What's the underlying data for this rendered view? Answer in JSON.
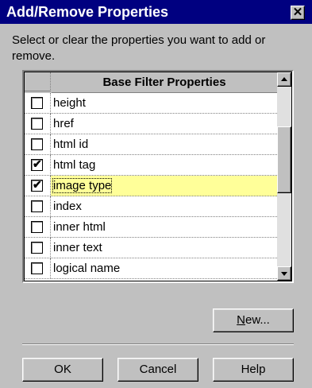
{
  "window": {
    "title": "Add/Remove Properties",
    "close_symbol": "✕"
  },
  "instructions": "Select or clear the properties you want to add or remove.",
  "table": {
    "header": "Base Filter Properties",
    "rows": [
      {
        "label": "height",
        "checked": false,
        "selected": false
      },
      {
        "label": "href",
        "checked": false,
        "selected": false
      },
      {
        "label": "html id",
        "checked": false,
        "selected": false
      },
      {
        "label": "html tag",
        "checked": true,
        "selected": false
      },
      {
        "label": "image type",
        "checked": true,
        "selected": true
      },
      {
        "label": "index",
        "checked": false,
        "selected": false
      },
      {
        "label": "inner html",
        "checked": false,
        "selected": false
      },
      {
        "label": "inner text",
        "checked": false,
        "selected": false
      },
      {
        "label": "logical name",
        "checked": false,
        "selected": false
      }
    ],
    "check_mark": "✔"
  },
  "buttons": {
    "new_label_underlined": "N",
    "new_label_rest": "ew...",
    "ok_label": "OK",
    "cancel_label": "Cancel",
    "help_label": "Help"
  },
  "colors": {
    "title_bar": "#000080",
    "dialog_bg": "#c0c0c0",
    "selected_row": "#ffff99"
  }
}
